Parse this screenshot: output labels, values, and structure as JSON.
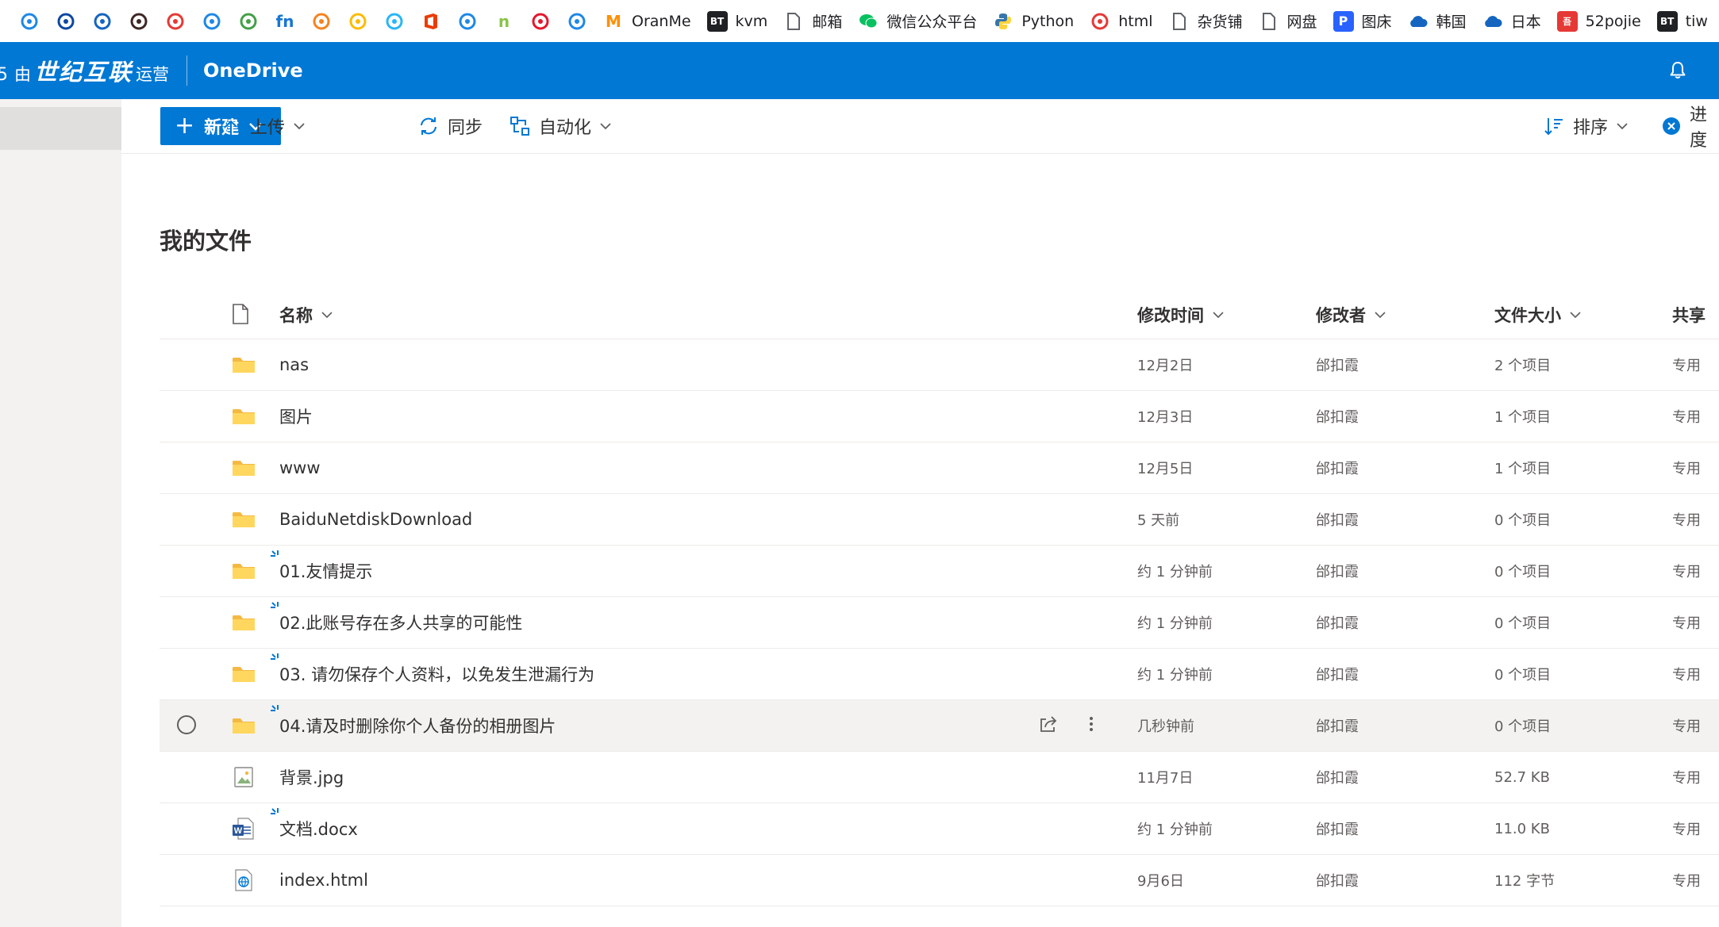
{
  "bookmarks": [
    {
      "label": "",
      "icon": "s-swirl-icon",
      "color": "#1e88e5"
    },
    {
      "label": "",
      "icon": "ring-icon",
      "color": "#0d47a1"
    },
    {
      "label": "",
      "icon": "stack-icon",
      "color": "#1565c0"
    },
    {
      "label": "",
      "icon": "owl-icon",
      "color": "#3e2723"
    },
    {
      "label": "",
      "icon": "pdf-icon",
      "color": "#e53935"
    },
    {
      "label": "",
      "icon": "image-icon",
      "color": "#1e88e5"
    },
    {
      "label": "",
      "icon": "petals-icon",
      "color": "#43a047"
    },
    {
      "label": "",
      "icon": "fn-icon",
      "color": "#1976d2"
    },
    {
      "label": "",
      "icon": "cloudflare-icon",
      "color": "#f6821f"
    },
    {
      "label": "",
      "icon": "drive-icon",
      "color": "#fbbc04"
    },
    {
      "label": "",
      "icon": "w-icon",
      "color": "#29b6f6"
    },
    {
      "label": "",
      "icon": "office-icon",
      "color": "#eb3c00"
    },
    {
      "label": "",
      "icon": "chart-icon",
      "color": "#1e88e5"
    },
    {
      "label": "",
      "icon": "n-icon",
      "color": "#8bc34a"
    },
    {
      "label": "",
      "icon": "weibo-icon",
      "color": "#e6162d"
    },
    {
      "label": "",
      "icon": "cloud-outline-icon",
      "color": "#1e88e5"
    },
    {
      "label": "OranMe",
      "icon": "oranme-icon",
      "color": "#ff8f00"
    },
    {
      "label": "kvm",
      "icon": "bt-icon",
      "color": "#202124"
    },
    {
      "label": "邮箱",
      "icon": "page-icon",
      "color": "#5f6368"
    },
    {
      "label": "微信公众平台",
      "icon": "wechat-icon",
      "color": "#07c160"
    },
    {
      "label": "Python",
      "icon": "python-icon",
      "color": "#3776ab"
    },
    {
      "label": "html",
      "icon": "shield-icon",
      "color": "#e53935"
    },
    {
      "label": "杂货铺",
      "icon": "page-icon",
      "color": "#5f6368"
    },
    {
      "label": "网盘",
      "icon": "page-icon",
      "color": "#5f6368"
    },
    {
      "label": "图床",
      "icon": "p-icon",
      "color": "#2962ff"
    },
    {
      "label": "韩国",
      "icon": "cloud-icon",
      "color": "#1565c0"
    },
    {
      "label": "日本",
      "icon": "cloud-icon",
      "color": "#1565c0"
    },
    {
      "label": "52pojie",
      "icon": "52-icon",
      "color": "#e53935"
    },
    {
      "label": "tiw",
      "icon": "bt-icon",
      "color": "#202124"
    }
  ],
  "suite": {
    "brand_num": "5",
    "brand_by": "由",
    "brand_name": "世纪互联",
    "brand_op": "运营",
    "app_name": "OneDrive"
  },
  "commands": {
    "new_label": "新建",
    "upload_label": "上传",
    "sync_label": "同步",
    "automate_label": "自动化",
    "sort_label": "排序",
    "progress_label": "进度"
  },
  "page_title": "我的文件",
  "columns": {
    "name": "名称",
    "modified": "修改时间",
    "modified_by": "修改者",
    "size": "文件大小",
    "sharing": "共享"
  },
  "files": [
    {
      "name": "nas",
      "type": "folder",
      "modified": "12月2日",
      "by": "邰扣霞",
      "size": "2 个项目",
      "share": "专用",
      "is_new": false
    },
    {
      "name": "图片",
      "type": "folder",
      "modified": "12月3日",
      "by": "邰扣霞",
      "size": "1 个项目",
      "share": "专用",
      "is_new": false
    },
    {
      "name": "www",
      "type": "folder",
      "modified": "12月5日",
      "by": "邰扣霞",
      "size": "1 个项目",
      "share": "专用",
      "is_new": false
    },
    {
      "name": "BaiduNetdiskDownload",
      "type": "folder",
      "modified": "5 天前",
      "by": "邰扣霞",
      "size": "0 个项目",
      "share": "专用",
      "is_new": false
    },
    {
      "name": "01.友情提示",
      "type": "folder",
      "modified": "约 1 分钟前",
      "by": "邰扣霞",
      "size": "0 个项目",
      "share": "专用",
      "is_new": true
    },
    {
      "name": "02.此账号存在多人共享的可能性",
      "type": "folder",
      "modified": "约 1 分钟前",
      "by": "邰扣霞",
      "size": "0 个项目",
      "share": "专用",
      "is_new": true
    },
    {
      "name": "03. 请勿保存个人资料，以免发生泄漏行为",
      "type": "folder",
      "modified": "约 1 分钟前",
      "by": "邰扣霞",
      "size": "0 个项目",
      "share": "专用",
      "is_new": true
    },
    {
      "name": "04.请及时删除你个人备份的相册图片",
      "type": "folder",
      "modified": "几秒钟前",
      "by": "邰扣霞",
      "size": "0 个项目",
      "share": "专用",
      "is_new": true,
      "hover": true
    },
    {
      "name": "背景.jpg",
      "type": "image",
      "modified": "11月7日",
      "by": "邰扣霞",
      "size": "52.7 KB",
      "share": "专用",
      "is_new": false
    },
    {
      "name": "文档.docx",
      "type": "word",
      "modified": "约 1 分钟前",
      "by": "邰扣霞",
      "size": "11.0 KB",
      "share": "专用",
      "is_new": true
    },
    {
      "name": "index.html",
      "type": "html",
      "modified": "9月6日",
      "by": "邰扣霞",
      "size": "112 字节",
      "share": "专用",
      "is_new": false
    }
  ],
  "colors": {
    "accent": "#0078d4",
    "folder": "#ffd75e",
    "folder_dark": "#f4b942",
    "nav_bg": "#f3f2f1"
  }
}
